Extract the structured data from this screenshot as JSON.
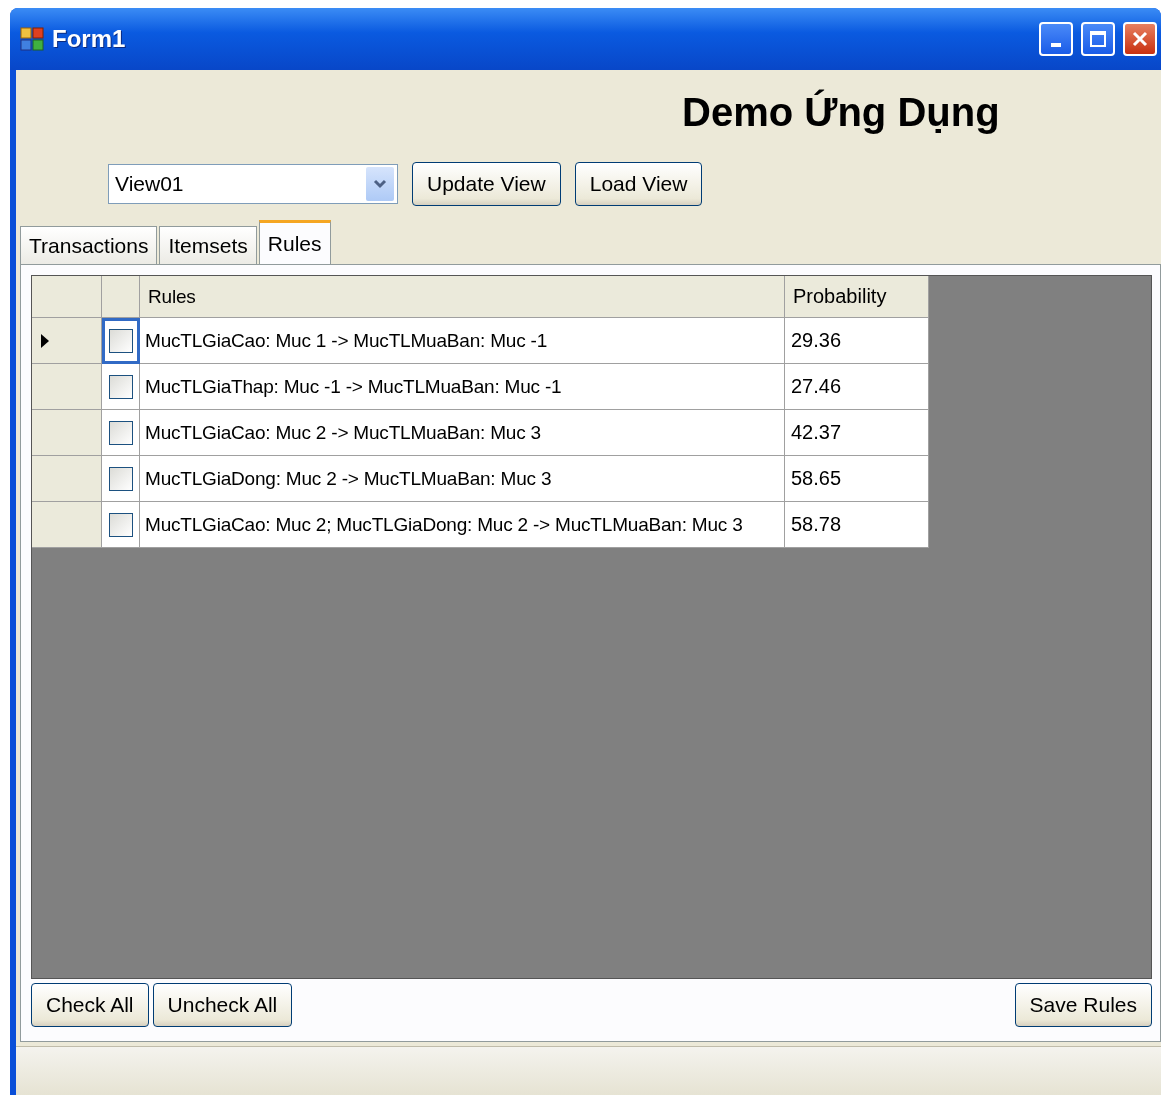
{
  "window": {
    "title": "Form1"
  },
  "heading": "Demo Ứng Dụng",
  "view_select": {
    "value": "View01"
  },
  "toolbar_buttons": [
    "Update View",
    "Load View"
  ],
  "tabs": [
    {
      "label": "Transactions",
      "selected": false
    },
    {
      "label": "Itemsets",
      "selected": false
    },
    {
      "label": "Rules",
      "selected": true
    }
  ],
  "grid": {
    "columns": [
      "Rules",
      "Probability"
    ],
    "rows": [
      {
        "selected": true,
        "checked": false,
        "rule": "MucTLGiaCao: Muc 1 -> MucTLMuaBan: Muc -1",
        "probability": "29.36"
      },
      {
        "selected": false,
        "checked": false,
        "rule": "MucTLGiaThap: Muc -1 -> MucTLMuaBan: Muc -1",
        "probability": "27.46"
      },
      {
        "selected": false,
        "checked": false,
        "rule": "MucTLGiaCao: Muc 2 -> MucTLMuaBan: Muc 3",
        "probability": "42.37"
      },
      {
        "selected": false,
        "checked": false,
        "rule": "MucTLGiaDong: Muc 2 -> MucTLMuaBan: Muc 3",
        "probability": "58.65"
      },
      {
        "selected": false,
        "checked": false,
        "rule": "MucTLGiaCao: Muc 2; MucTLGiaDong: Muc 2 -> MucTLMuaBan: Muc 3",
        "probability": "58.78"
      }
    ]
  },
  "bottom_buttons_left": [
    "Check All",
    "Uncheck All"
  ],
  "bottom_button_right": "Save Rules"
}
